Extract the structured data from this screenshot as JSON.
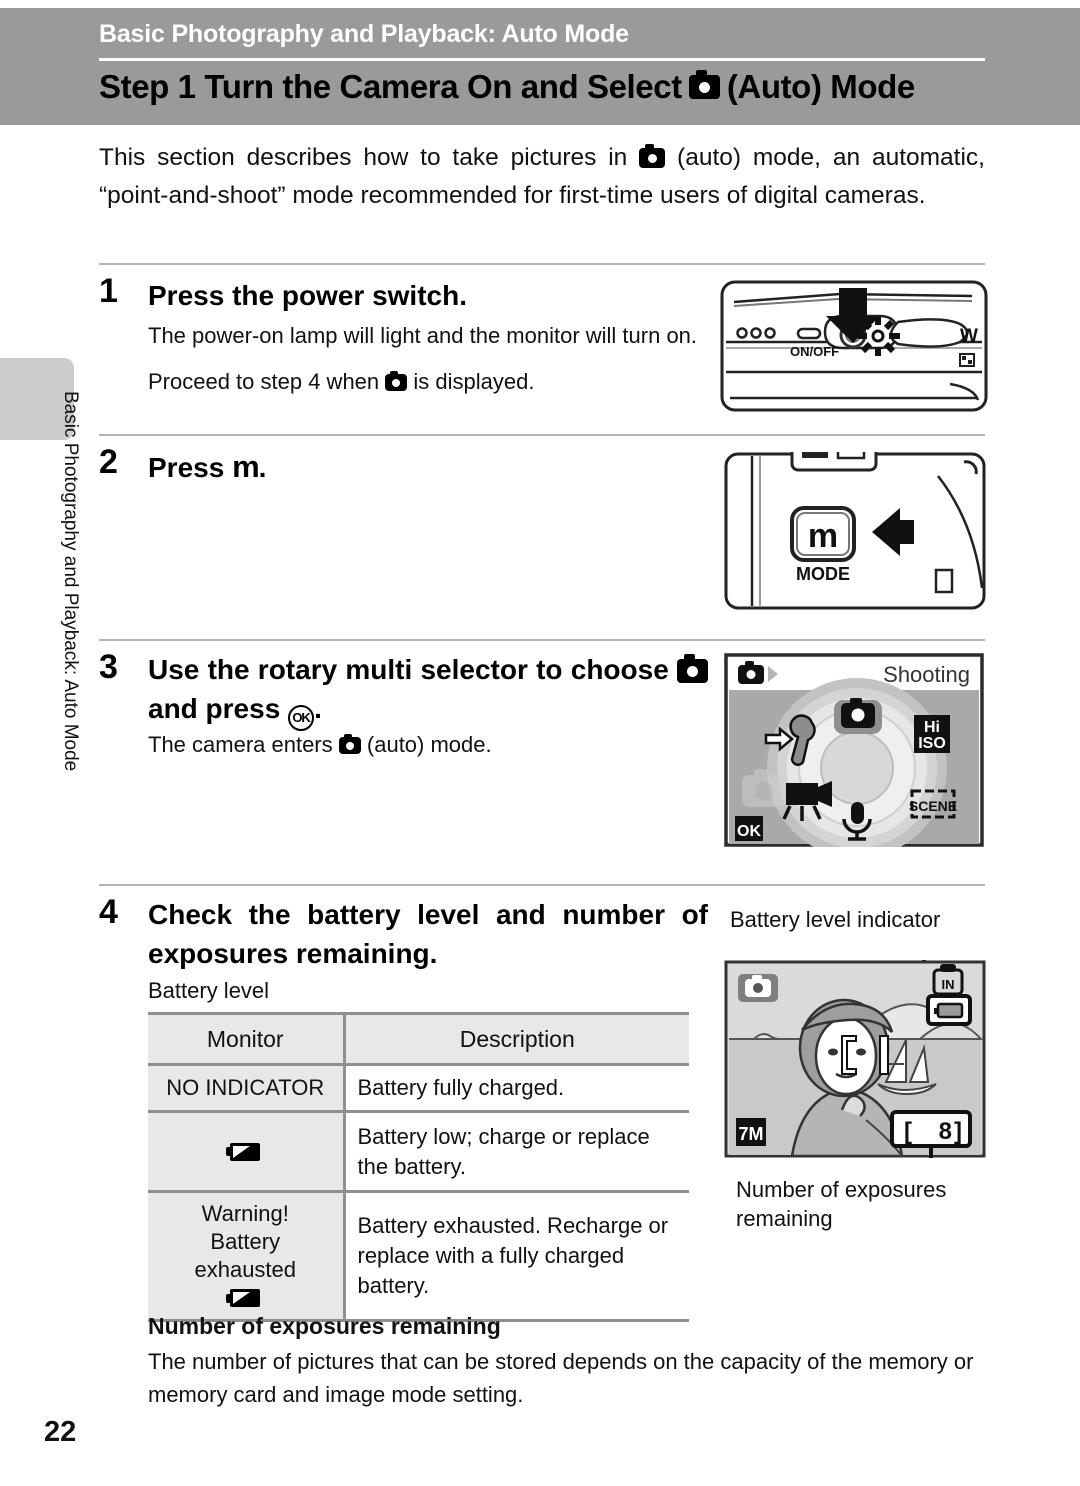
{
  "header": {
    "chapter": "Basic Photography and Playback: Auto Mode",
    "title_prefix": "Step 1 Turn the Camera On and Select",
    "title_suffix": "(Auto) Mode"
  },
  "sidebar": {
    "vertical_running_head": "Basic Photography and Playback: Auto Mode"
  },
  "intro": {
    "part1": "This section describes how to take pictures in",
    "part2": "(auto) mode, an automatic, “point-and-shoot” mode recommended for first-time users of digital cameras."
  },
  "steps": [
    {
      "number": "1",
      "heading": "Press the power switch.",
      "body1": "The power-on lamp will light and the monitor will turn on.",
      "body2_pre": "Proceed to step 4 when",
      "body2_post": "is displayed.",
      "figure": {
        "name": "camera-top-power-switch",
        "onoff_label": "ON/OFF",
        "zoom_w_label": "W"
      }
    },
    {
      "number": "2",
      "heading_pre": "Press",
      "heading_icon": "m",
      "heading_post": ".",
      "figure": {
        "name": "camera-back-mode-button",
        "button_glyph": "m",
        "button_label": "MODE"
      }
    },
    {
      "number": "3",
      "heading_pre": "Use the rotary multi selector to choose",
      "heading_mid": "and press",
      "heading_post": ".",
      "body_pre": "The camera enters",
      "body_post": "(auto) mode.",
      "figure": {
        "name": "mode-dial-screen",
        "title": "Shooting",
        "ok_badge": "OK",
        "items": [
          {
            "name": "auto-mode-icon",
            "label": ""
          },
          {
            "name": "high-iso-icon",
            "label": "Hi ISO"
          },
          {
            "name": "scene-mode-icon",
            "label": "SCENE"
          },
          {
            "name": "voice-recording-icon",
            "label": ""
          },
          {
            "name": "movie-mode-icon",
            "label": ""
          },
          {
            "name": "setup-wrench-icon",
            "label": ""
          }
        ]
      }
    },
    {
      "number": "4",
      "heading": "Check the battery level and number of exposures remaining.",
      "subheading": "Battery level"
    }
  ],
  "battery_table": {
    "columns": [
      "Monitor",
      "Description"
    ],
    "rows": [
      {
        "monitor_text": "NO INDICATOR",
        "monitor_icon": "",
        "description": "Battery fully charged."
      },
      {
        "monitor_text": "",
        "monitor_icon": "battery-low-icon",
        "description": "Battery low; charge or replace the battery."
      },
      {
        "monitor_text": "Warning!\nBattery\nexhausted",
        "monitor_icon": "battery-exhausted-icon",
        "description": "Battery exhausted. Recharge or replace with a fully charged battery."
      }
    ]
  },
  "monitor_figure": {
    "top_label": "Battery level indicator",
    "bottom_label": "Number of exposures remaining",
    "image_mode_badge": "7M",
    "exposures_value": "8",
    "exposures_bracket_left": "[",
    "exposures_bracket_right": "]"
  },
  "exposures_note": {
    "heading": "Number of exposures remaining",
    "body": "The number of pictures that can be stored depends on the capacity of the memory or memory card and image mode setting."
  },
  "page_number": "22",
  "colors": {
    "header_gray": "#9a9a9a",
    "side_tab_gray": "#cccccc",
    "rule_gray": "#b4b4b4",
    "table_cell_gray": "#e8e8e8",
    "table_border_gray": "#8f8f8f"
  }
}
